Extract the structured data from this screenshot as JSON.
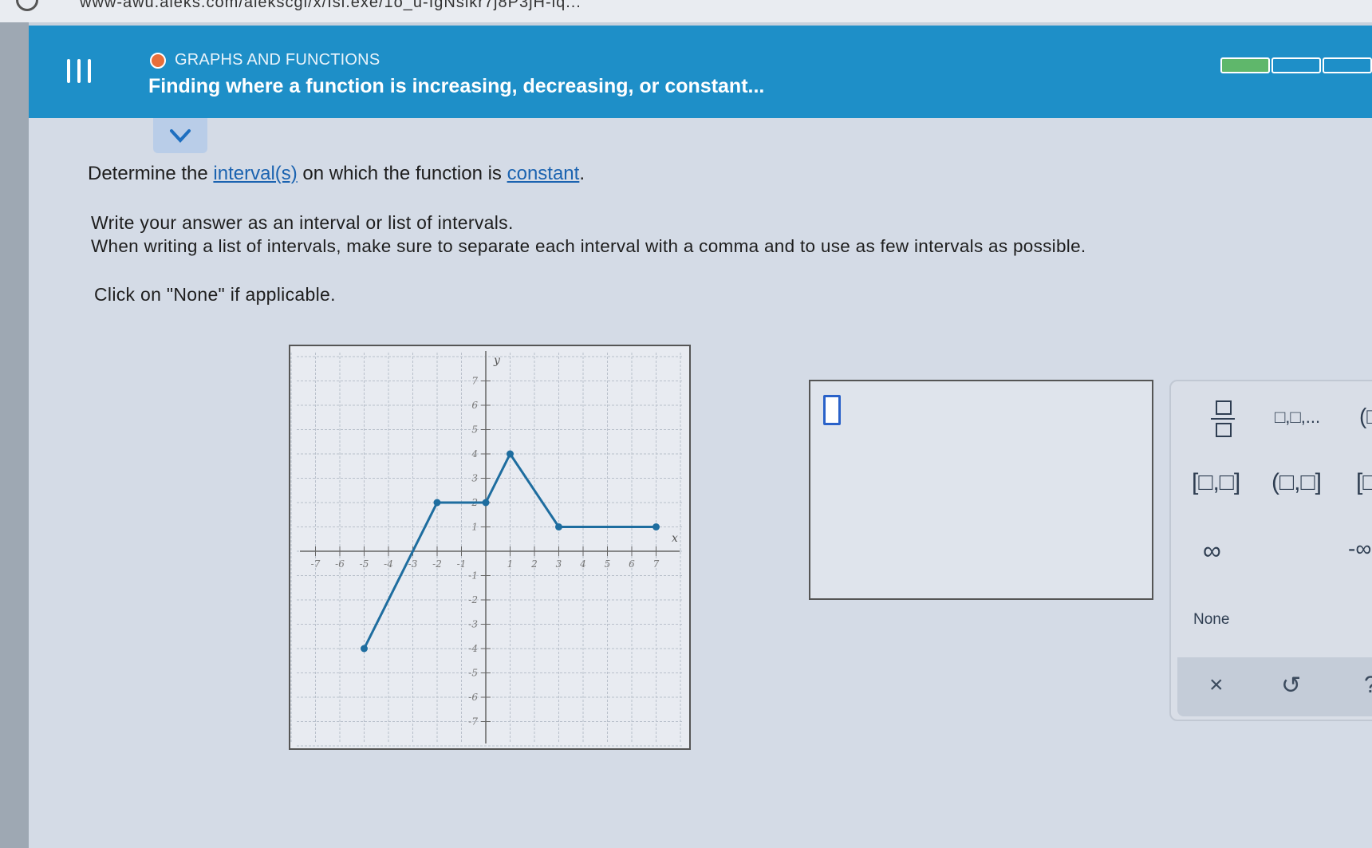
{
  "browser": {
    "url": "www-awu.aleks.com/alekscgi/x/Isl.exe/1o_u-IgNslkr7j8P3jH-lq..."
  },
  "header": {
    "section": "GRAPHS AND FUNCTIONS",
    "title": "Finding where a function is increasing, decreasing, or constant...",
    "progress": {
      "filled_segments": 1,
      "total_segments": 3
    }
  },
  "question": {
    "prefix": "Determine the ",
    "link1": "interval(s)",
    "middle": " on which the function is ",
    "link2": "constant",
    "suffix": "."
  },
  "instructions": {
    "line1": "Write your answer as an interval or list of intervals.",
    "line2": "When writing a list of intervals, make sure to separate each interval with a comma and to use as few intervals as possible.",
    "line3": "Click on \"None\" if applicable."
  },
  "graph": {
    "x_axis_label": "x",
    "y_axis_label": "y",
    "x_range": [
      -7,
      7
    ],
    "y_range": [
      -7,
      7
    ],
    "x_ticks": [
      "-7",
      "-6",
      "-5",
      "-4",
      "-3",
      "-2",
      "-1",
      "1",
      "2",
      "3",
      "4",
      "5",
      "6",
      "7"
    ],
    "y_ticks": [
      "7",
      "6",
      "5",
      "4",
      "3",
      "2",
      "1",
      "-1",
      "-2",
      "-3",
      "-4",
      "-5",
      "-6",
      "-7"
    ],
    "points": [
      [
        -5,
        -4
      ],
      [
        -2,
        2
      ],
      [
        0,
        2
      ],
      [
        1,
        4
      ],
      [
        3,
        1
      ],
      [
        7,
        1
      ]
    ],
    "line_color": "#1e6d9f"
  },
  "keypad": {
    "list_key": "□,□,...",
    "open_paren_partial": "(□",
    "closed_interval": "[□,□]",
    "half_open_interval": "(□,□]",
    "partial_bracket": "[□",
    "infinity": "∞",
    "neg_infinity_partial": "-∞",
    "none_label": "None",
    "clear": "×",
    "undo": "↺",
    "help": "?"
  },
  "colors": {
    "header_blue": "#1e8fc8",
    "status_orange": "#e86e3a",
    "progress_green": "#5fb76b",
    "link_blue": "#1b63b0"
  }
}
